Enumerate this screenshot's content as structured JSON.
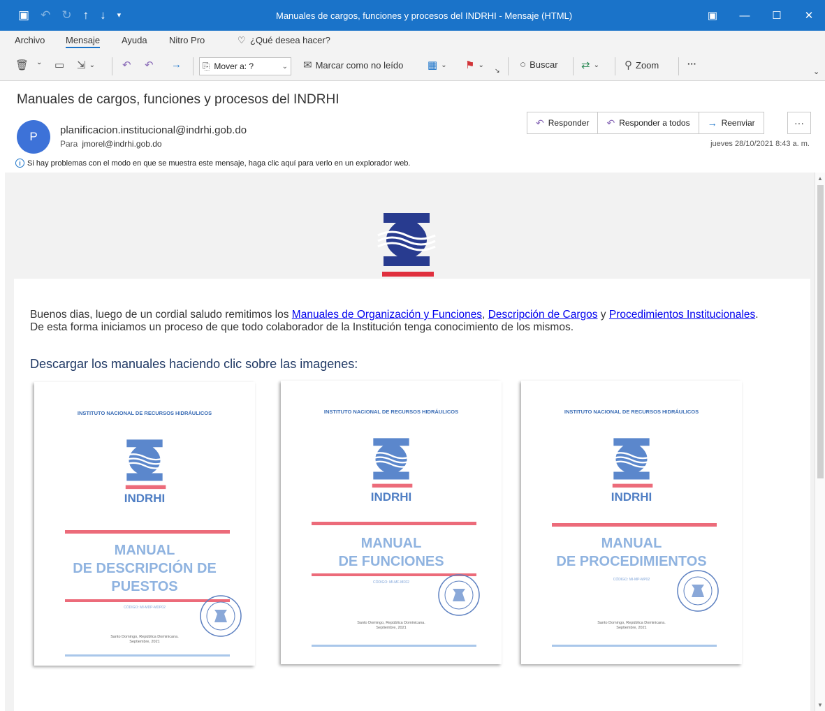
{
  "window": {
    "title": "Manuales de cargos, funciones y procesos del INDRHI  -  Mensaje (HTML)",
    "colors": {
      "titlebar": "#1a73c9",
      "accent": "#1a73c9"
    }
  },
  "menu": {
    "items": [
      "Archivo",
      "Mensaje",
      "Ayuda",
      "Nitro Pro"
    ],
    "tell_me": "¿Qué desea hacer?"
  },
  "toolbar": {
    "move_to": "Mover a: ?",
    "mark_unread": "Marcar como no leído",
    "search": "Buscar",
    "zoom": "Zoom",
    "more": "···"
  },
  "message": {
    "subject": "Manuales de cargos, funciones y procesos del INDRHI",
    "avatar_letter": "P",
    "sender": "planificacion.institucional@indrhi.gob.do",
    "to_label": "Para",
    "to": "jmorel@indrhi.gob.do",
    "info": "Si hay problemas con el modo en que se muestra este mensaje, haga clic aquí para verlo en un explorador web.",
    "date": "jueves 28/10/2021 8:43 a. m.",
    "actions": {
      "reply": "Responder",
      "reply_all": "Responder a todos",
      "forward": "Reenviar",
      "more": "···"
    }
  },
  "body": {
    "p1_start": "Buenos dias, luego de un cordial saludo remitimos los ",
    "link1": "Manuales de Organización y Funciones",
    "comma": ", ",
    "link2": "Descripción de Cargos",
    "y": " y ",
    "link3": "Procedimientos Institucionales",
    "p1_end": ".",
    "p2": "De esta forma iniciamos un proceso de que todo colaborador de la Institución tenga conocimiento de los mismos.",
    "heading": "Descargar los manuales haciendo clic sobre las imagenes:",
    "manuals": [
      {
        "institution": "INSTITUTO NACIONAL DE RECURSOS HIDRÁULICOS",
        "org": "INDRHI",
        "title_lines": [
          "MANUAL",
          "DE DESCRIPCIÓN DE",
          "PUESTOS"
        ],
        "code": "CÓDIGO: MI-MDP-MDP02",
        "place": "Santo Domingo, República Dominicana.",
        "date": "Septiembre, 2021"
      },
      {
        "institution": "INSTITUTO NACIONAL DE RECURSOS HIDRÁULICOS",
        "org": "INDRHI",
        "title_lines": [
          "MANUAL",
          "DE FUNCIONES"
        ],
        "code": "CÓDIGO: MI-MF-MF02",
        "place": "Santo Domingo, República Dominicana.",
        "date": "Septiembre, 2021"
      },
      {
        "institution": "INSTITUTO NACIONAL DE RECURSOS HIDRÁULICOS",
        "org": "INDRHI",
        "title_lines": [
          "MANUAL",
          "DE PROCEDIMIENTOS"
        ],
        "code": "CÓDIGO: MI-MP-MP02",
        "place": "Santo Domingo, República Dominicana.",
        "date": "Septiembre, 2021"
      }
    ]
  }
}
